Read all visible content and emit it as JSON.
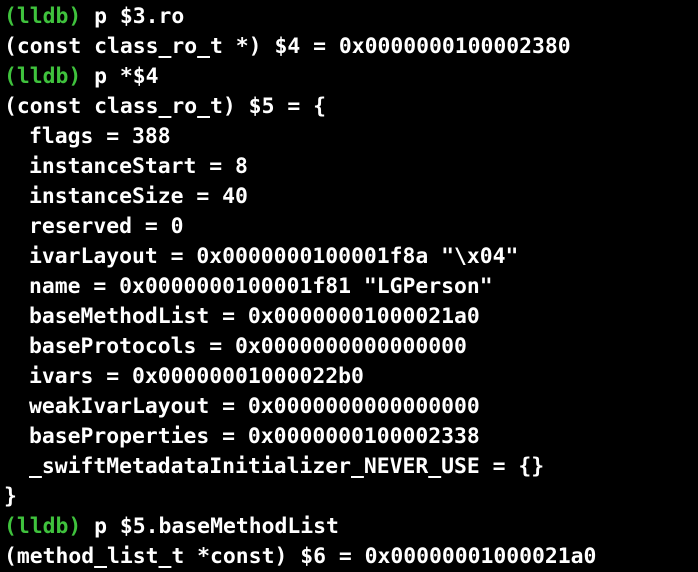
{
  "colors": {
    "background": "#000000",
    "prompt": "#3fc23d",
    "text": "#ffffff"
  },
  "terminal": {
    "lines": [
      {
        "prompt": "(lldb)",
        "command": " p $3.ro"
      },
      {
        "text": "(const class_ro_t *) $4 = 0x0000000100002380"
      },
      {
        "prompt": "(lldb)",
        "command": " p *$4"
      },
      {
        "text": "(const class_ro_t) $5 = {"
      },
      {
        "text": "flags = 388"
      },
      {
        "text": "instanceStart = 8"
      },
      {
        "text": "instanceSize = 40"
      },
      {
        "text": "reserved = 0"
      },
      {
        "text": "ivarLayout = 0x0000000100001f8a \"\\x04\""
      },
      {
        "text": "name = 0x0000000100001f81 \"LGPerson\""
      },
      {
        "text": "baseMethodList = 0x00000001000021a0"
      },
      {
        "text": "baseProtocols = 0x0000000000000000"
      },
      {
        "text": "ivars = 0x00000001000022b0"
      },
      {
        "text": "weakIvarLayout = 0x0000000000000000"
      },
      {
        "text": "baseProperties = 0x0000000100002338"
      },
      {
        "text": "_swiftMetadataInitializer_NEVER_USE = {}"
      },
      {
        "text": "}"
      },
      {
        "prompt": "(lldb)",
        "command": " p $5.baseMethodList"
      },
      {
        "text": "(method_list_t *const) $6 = 0x00000001000021a0"
      }
    ]
  }
}
